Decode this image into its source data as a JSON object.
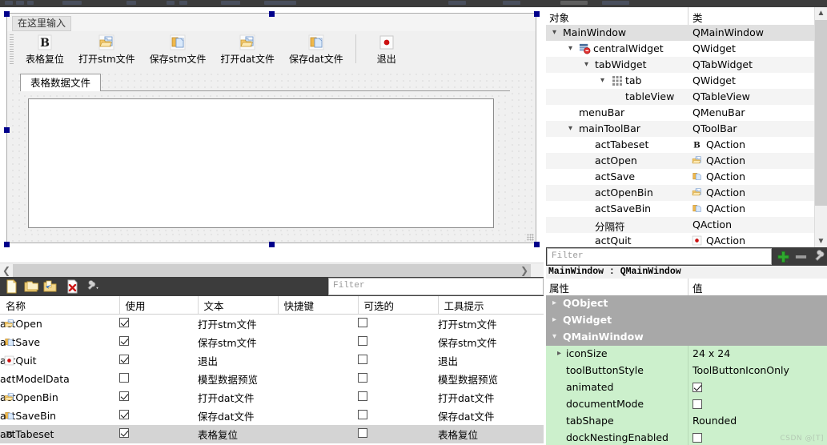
{
  "designer": {
    "menu_placeholder": "在这里输入",
    "toolbar_buttons": [
      {
        "label": "表格复位",
        "icon": "bold-b-icon"
      },
      {
        "label": "打开stm文件",
        "icon": "open-folder-icon"
      },
      {
        "label": "保存stm文件",
        "icon": "copy-save-icon"
      },
      {
        "label": "打开dat文件",
        "icon": "open-folder-icon"
      },
      {
        "label": "保存dat文件",
        "icon": "copy-save-icon"
      },
      {
        "label": "退出",
        "icon": "red-dot-icon"
      }
    ],
    "tab_label": "表格数据文件"
  },
  "action_editor": {
    "toolbar_icons": [
      "new-action-icon",
      "copy-action-icon",
      "edit-action-icon",
      "delete-action-icon",
      "configure-icon"
    ],
    "filter_placeholder": "Filter",
    "columns": [
      "名称",
      "使用",
      "文本",
      "快捷键",
      "可选的",
      "工具提示"
    ],
    "rows": [
      {
        "icon": "open-folder-icon",
        "name": "actOpen",
        "used": true,
        "text": "打开stm文件",
        "shortcut": "",
        "checkable": false,
        "tooltip": "打开stm文件",
        "selected": false
      },
      {
        "icon": "copy-save-icon",
        "name": "actSave",
        "used": true,
        "text": "保存stm文件",
        "shortcut": "",
        "checkable": false,
        "tooltip": "保存stm文件",
        "selected": false
      },
      {
        "icon": "red-dot-icon",
        "name": "actQuit",
        "used": true,
        "text": "退出",
        "shortcut": "",
        "checkable": false,
        "tooltip": "退出",
        "selected": false
      },
      {
        "icon": "italic-i-icon",
        "name": "actModelData",
        "used": false,
        "text": "模型数据预览",
        "shortcut": "",
        "checkable": false,
        "tooltip": "模型数据预览",
        "selected": false
      },
      {
        "icon": "open-folder-icon",
        "name": "actOpenBin",
        "used": true,
        "text": "打开dat文件",
        "shortcut": "",
        "checkable": false,
        "tooltip": "打开dat文件",
        "selected": false
      },
      {
        "icon": "copy-save-icon",
        "name": "actSaveBin",
        "used": true,
        "text": "保存dat文件",
        "shortcut": "",
        "checkable": false,
        "tooltip": "保存dat文件",
        "selected": false
      },
      {
        "icon": "bold-b-icon",
        "name": "actTabeset",
        "used": true,
        "text": "表格复位",
        "shortcut": "",
        "checkable": false,
        "tooltip": "表格复位",
        "selected": true
      }
    ]
  },
  "object_inspector": {
    "columns": [
      "对象",
      "类"
    ],
    "rows": [
      {
        "name": "MainWindow",
        "class": "QMainWindow",
        "indent": 0,
        "expander": "down",
        "icon": "",
        "class_icon": "",
        "selected": true
      },
      {
        "name": "centralWidget",
        "class": "QWidget",
        "indent": 1,
        "expander": "down",
        "icon": "layout-break-icon",
        "class_icon": "",
        "selected": false
      },
      {
        "name": "tabWidget",
        "class": "QTabWidget",
        "indent": 2,
        "expander": "down",
        "icon": "",
        "class_icon": "",
        "selected": false
      },
      {
        "name": "tab",
        "class": "QWidget",
        "indent": 3,
        "expander": "down",
        "icon": "grid-icon",
        "class_icon": "",
        "selected": false
      },
      {
        "name": "tableView",
        "class": "QTableView",
        "indent": 4,
        "expander": "",
        "icon": "",
        "class_icon": "",
        "selected": false
      },
      {
        "name": "menuBar",
        "class": "QMenuBar",
        "indent": 1,
        "expander": "",
        "icon": "",
        "class_icon": "",
        "selected": false
      },
      {
        "name": "mainToolBar",
        "class": "QToolBar",
        "indent": 1,
        "expander": "down",
        "icon": "",
        "class_icon": "",
        "selected": false
      },
      {
        "name": "actTabeset",
        "class": "QAction",
        "indent": 2,
        "expander": "",
        "icon": "",
        "class_icon": "bold-b-icon",
        "selected": false
      },
      {
        "name": "actOpen",
        "class": "QAction",
        "indent": 2,
        "expander": "",
        "icon": "",
        "class_icon": "open-folder-icon",
        "selected": false
      },
      {
        "name": "actSave",
        "class": "QAction",
        "indent": 2,
        "expander": "",
        "icon": "",
        "class_icon": "copy-save-icon",
        "selected": false
      },
      {
        "name": "actOpenBin",
        "class": "QAction",
        "indent": 2,
        "expander": "",
        "icon": "",
        "class_icon": "open-folder-icon",
        "selected": false
      },
      {
        "name": "actSaveBin",
        "class": "QAction",
        "indent": 2,
        "expander": "",
        "icon": "",
        "class_icon": "copy-save-icon",
        "selected": false
      },
      {
        "name": "分隔符",
        "class": "QAction",
        "indent": 2,
        "expander": "",
        "icon": "",
        "class_icon": "",
        "selected": false
      },
      {
        "name": "actQuit",
        "class": "QAction",
        "indent": 2,
        "expander": "",
        "icon": "",
        "class_icon": "red-dot-icon",
        "selected": false
      }
    ]
  },
  "property_editor": {
    "filter_placeholder": "Filter",
    "add_icon": "plus-icon",
    "remove_icon": "minus-icon",
    "configure_icon": "wrench-icon",
    "object_line": "MainWindow : QMainWindow",
    "columns": [
      "属性",
      "值"
    ],
    "rows": [
      {
        "kind": "group",
        "name": "QObject",
        "value": "",
        "expander": "right"
      },
      {
        "kind": "group",
        "name": "QWidget",
        "value": "",
        "expander": "right"
      },
      {
        "kind": "group",
        "name": "QMainWindow",
        "value": "",
        "expander": "down"
      },
      {
        "kind": "value",
        "name": "iconSize",
        "value": "24 x 24",
        "expander": "right",
        "indent": 1
      },
      {
        "kind": "value",
        "name": "toolButtonStyle",
        "value": "ToolButtonIconOnly",
        "expander": "",
        "indent": 1
      },
      {
        "kind": "check",
        "name": "animated",
        "value": true,
        "expander": "",
        "indent": 1
      },
      {
        "kind": "check",
        "name": "documentMode",
        "value": false,
        "expander": "",
        "indent": 1
      },
      {
        "kind": "value",
        "name": "tabShape",
        "value": "Rounded",
        "expander": "",
        "indent": 1
      },
      {
        "kind": "check",
        "name": "dockNestingEnabled",
        "value": false,
        "expander": "",
        "indent": 1
      }
    ],
    "watermark": "CSDN @[T]"
  }
}
